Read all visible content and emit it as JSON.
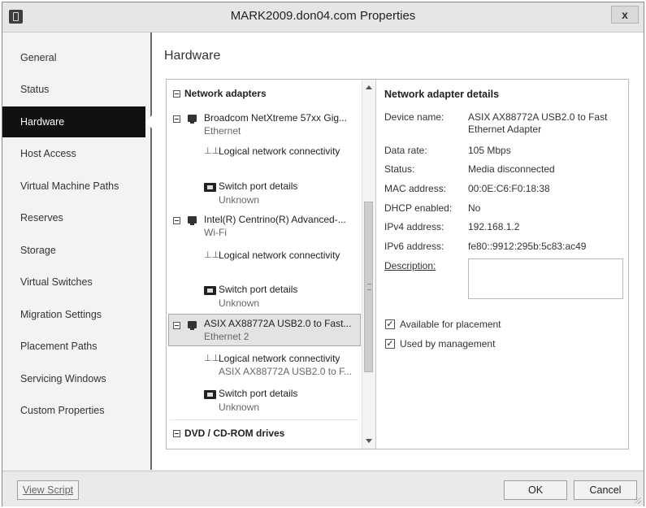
{
  "window": {
    "title": "MARK2009.don04.com Properties",
    "close_glyph": "x"
  },
  "nav": {
    "items": [
      {
        "label": "General"
      },
      {
        "label": "Status"
      },
      {
        "label": "Hardware",
        "active": true
      },
      {
        "label": "Host Access"
      },
      {
        "label": "Virtual Machine Paths"
      },
      {
        "label": "Reserves"
      },
      {
        "label": "Storage"
      },
      {
        "label": "Virtual Switches"
      },
      {
        "label": "Migration Settings"
      },
      {
        "label": "Placement Paths"
      },
      {
        "label": "Servicing Windows"
      },
      {
        "label": "Custom Properties"
      }
    ]
  },
  "main": {
    "title": "Hardware"
  },
  "tree": {
    "group_network": "Network adapters",
    "adapters": [
      {
        "name": "Broadcom NetXtreme 57xx Gig...",
        "type": "Ethernet",
        "logical": "Logical network connectivity",
        "logical_sub": "",
        "switch": "Switch port details",
        "switch_sub": "Unknown"
      },
      {
        "name": "Intel(R) Centrino(R) Advanced-...",
        "type": "Wi-Fi",
        "logical": "Logical network connectivity",
        "logical_sub": "",
        "switch": "Switch port details",
        "switch_sub": "Unknown"
      },
      {
        "name": "ASIX AX88772A USB2.0 to Fast...",
        "type": "Ethernet 2",
        "logical": "Logical network connectivity",
        "logical_sub": "ASIX AX88772A USB2.0 to F...",
        "switch": "Switch port details",
        "switch_sub": "Unknown"
      }
    ],
    "group_dvd": "DVD / CD-ROM drives"
  },
  "details": {
    "header": "Network adapter details",
    "rows": [
      {
        "label": "Device name:",
        "value": "ASIX AX88772A USB2.0 to Fast Ethernet Adapter"
      },
      {
        "label": "Data rate:",
        "value": "105 Mbps"
      },
      {
        "label": "Status:",
        "value": "Media disconnected"
      },
      {
        "label": "MAC address:",
        "value": "00:0E:C6:F0:18:38"
      },
      {
        "label": "DHCP enabled:",
        "value": "No"
      },
      {
        "label": "IPv4 address:",
        "value": "192.168.1.2"
      },
      {
        "label": "IPv6 address:",
        "value": "fe80::9912:295b:5c83:ac49"
      },
      {
        "label": "Description:",
        "value": ""
      }
    ],
    "available_label": "Available for placement",
    "available_checked": true,
    "management_label": "Used by management",
    "management_checked": true
  },
  "footer": {
    "view_script": "View Script",
    "ok": "OK",
    "cancel": "Cancel"
  },
  "icons": {
    "app": "window-icon",
    "adapter": "network-card-icon",
    "logical": "network-connectivity-icon",
    "switch": "switch-port-icon"
  }
}
